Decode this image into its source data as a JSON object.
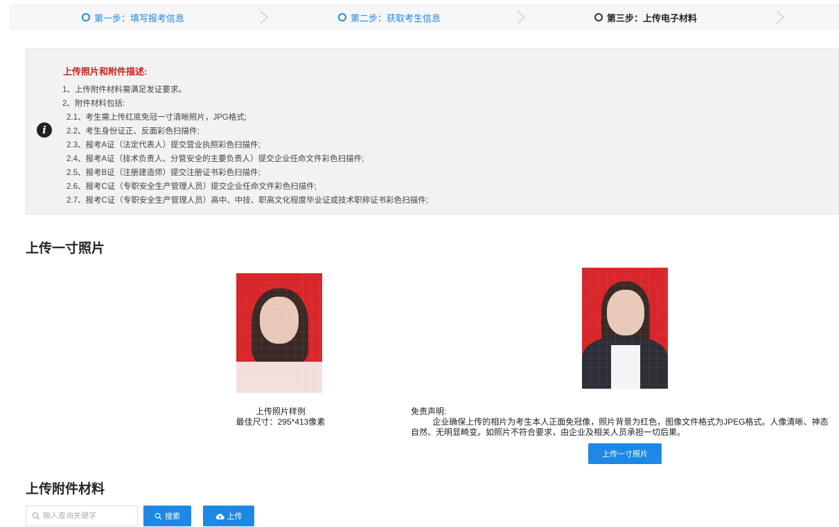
{
  "steps": [
    {
      "label": "第一步：填写报考信息",
      "state": "done"
    },
    {
      "label": "第二步：获取考生信息",
      "state": "done"
    },
    {
      "label": "第三步：上传电子材料",
      "state": "active"
    }
  ],
  "info": {
    "title": "上传照片和附件描述:",
    "lines": [
      "1、上传附件材料需满足发证要求。",
      "2、附件材料包括:",
      "2.1、考生需上传红底免冠一寸清晰照片，JPG格式;",
      "2.2、考生身份证正、反面彩色扫描件;",
      "2.3、报考A证（法定代表人）提交营业执照彩色扫描件;",
      "2.4、报考A证（技术负责人、分管安全的主要负责人）提交企业任命文件彩色扫描件;",
      "2.5、报考B证（注册建造师）提交注册证书彩色扫描件;",
      "2.6、报考C证（专职安全生产管理人员）提交企业任命文件彩色扫描件;",
      "2.7、报考C证（专职安全生产管理人员）高中、中技、职高文化程度毕业证或技术职称证书彩色扫描件;"
    ]
  },
  "photo_section": {
    "title": "上传一寸照片",
    "sample_caption": "上传照片样例",
    "sample_size": "最佳尺寸：295*413像素",
    "disclaimer_title": "免责声明:",
    "disclaimer_text": "企业确保上传的相片为考生本人正面免冠像，照片背景为红色，图像文件格式为JPEG格式。人像清晰、神态自然、无明显畸变。如照片不符合要求，由企业及相关人员承担一切后果。",
    "upload_button": "上传一寸照片"
  },
  "attachment_section": {
    "title": "上传附件材料",
    "search_placeholder": "输入查询关键字",
    "search_button": "搜索",
    "upload_button": "上传"
  },
  "colors": {
    "accent": "#1e88e5",
    "warning_title": "#cc1f1f",
    "photo_bg": "#d8262a"
  }
}
